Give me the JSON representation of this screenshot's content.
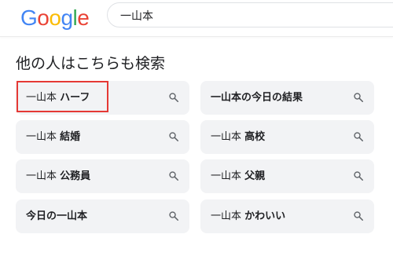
{
  "logo": {
    "letters": [
      "G",
      "o",
      "o",
      "g",
      "l",
      "e"
    ],
    "colors": [
      "#4285F4",
      "#EA4335",
      "#FBBC05",
      "#4285F4",
      "#34A853",
      "#EA4335"
    ]
  },
  "search": {
    "query": "一山本"
  },
  "section": {
    "title": "他の人はこちらも検索"
  },
  "related": [
    {
      "prefix": "一山本 ",
      "bold": "ハーフ",
      "icon": "search-icon"
    },
    {
      "prefix": "",
      "bold": "一山本の今日の結果",
      "icon": "search-icon"
    },
    {
      "prefix": "一山本 ",
      "bold": "結婚",
      "icon": "search-icon"
    },
    {
      "prefix": "一山本 ",
      "bold": "高校",
      "icon": "search-icon"
    },
    {
      "prefix": "一山本 ",
      "bold": "公務員",
      "icon": "search-icon"
    },
    {
      "prefix": "一山本 ",
      "bold": "父親",
      "icon": "search-icon"
    },
    {
      "prefix": "",
      "bold": "今日の一山本",
      "icon": "search-icon"
    },
    {
      "prefix": "一山本 ",
      "bold": "かわいい",
      "icon": "search-icon"
    }
  ],
  "highlight_color": "#e53935"
}
